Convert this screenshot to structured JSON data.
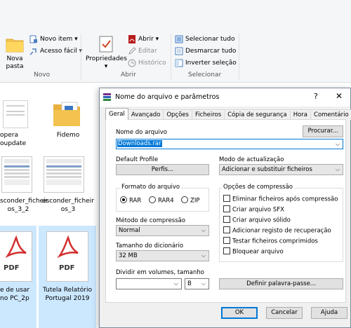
{
  "ribbon": {
    "new_folder": "Nova\npasta",
    "new_item": "Novo item",
    "easy_access": "Acesso fácil",
    "group_new": "Novo",
    "properties": "Propriedades",
    "open": "Abrir",
    "edit": "Editar",
    "history": "Histórico",
    "group_open": "Abrir",
    "select_all": "Selecionar tudo",
    "select_none": "Desmarcar tudo",
    "invert_selection": "Inverter seleção",
    "group_select": "Selecionar"
  },
  "files": [
    {
      "label": "opera\noupdate"
    },
    {
      "label": "Fidemo"
    },
    {
      "label": "sconder_ficheir\nos_3_2"
    },
    {
      "label": "esconder_ficheir\nos_3"
    },
    {
      "label": "e de usar\nno PC_2p"
    },
    {
      "label": "Tutela Relatório\nPortugal 2019"
    }
  ],
  "pdf_badge": "PDF",
  "dialog": {
    "title": "Nome do arquivo e parâmetros",
    "help_glyph": "?",
    "close_glyph": "✕",
    "tabs": [
      "Geral",
      "Avançado",
      "Opções",
      "Ficheiros",
      "Cópia de segurança",
      "Hora",
      "Comentário"
    ],
    "browse_button": "Procurar...",
    "archive_name_label": "Nome do arquivo",
    "archive_name_value": "Downloads.rar",
    "default_profile_label": "Default Profile",
    "profiles_button": "Perfis...",
    "update_mode_label": "Modo de actualização",
    "update_mode_value": "Adicionar e substituir ficheiros",
    "format_group": "Formato do arquivo",
    "format_options": [
      "RAR",
      "RAR4",
      "ZIP"
    ],
    "format_selected": "RAR",
    "compression_options_group": "Opções de compressão",
    "compression_options": [
      "Eliminar ficheiros após compressão",
      "Criar arquivo SFX",
      "Criar arquivo sólido",
      "Adicionar registo de recuperação",
      "Testar ficheiros comprimidos",
      "Bloquear arquivo"
    ],
    "compression_method_label": "Método de compressão",
    "compression_method_value": "Normal",
    "dictionary_size_label": "Tamanho do dicionário",
    "dictionary_size_value": "32 MB",
    "split_label": "Dividir em volumes, tamanho",
    "split_value": "",
    "split_unit": "B",
    "set_password_button": "Definir palavra-passe...",
    "ok_button": "OK",
    "cancel_button": "Cancelar",
    "help_button": "Ajuda"
  },
  "colors": {
    "accent": "#0078d7",
    "pdf_red": "#d32f2f",
    "folder_yellow": "#f3c24f"
  }
}
